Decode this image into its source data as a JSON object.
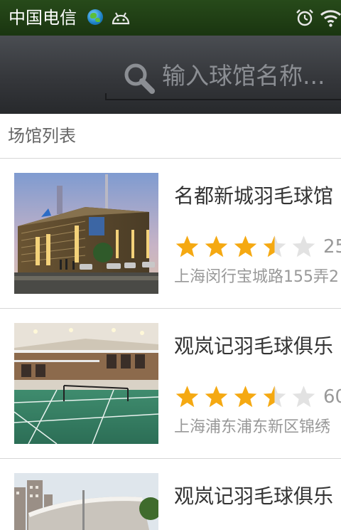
{
  "status_bar": {
    "carrier": "中国电信",
    "icons": [
      "globe-icon",
      "android-debug-icon",
      "alarm-icon",
      "wifi-icon"
    ],
    "background": "#274a1a"
  },
  "search": {
    "placeholder": "输入球馆名称...",
    "icon": "search-icon"
  },
  "section": {
    "title": "场馆列表"
  },
  "venues": [
    {
      "name": "名都新城羽毛球馆",
      "rating": 3.5,
      "rating_max": 5,
      "rating_count": "25",
      "address": "上海闵行宝城路155弄2"
    },
    {
      "name": "观岚记羽毛球俱乐",
      "rating": 3.5,
      "rating_max": 5,
      "rating_count": "60",
      "address": "上海浦东浦东新区锦绣"
    },
    {
      "name": "观岚记羽毛球俱乐"
    }
  ],
  "colors": {
    "star_filled": "#f5a912",
    "star_empty": "#e2e2e2",
    "header": "#35373b"
  }
}
